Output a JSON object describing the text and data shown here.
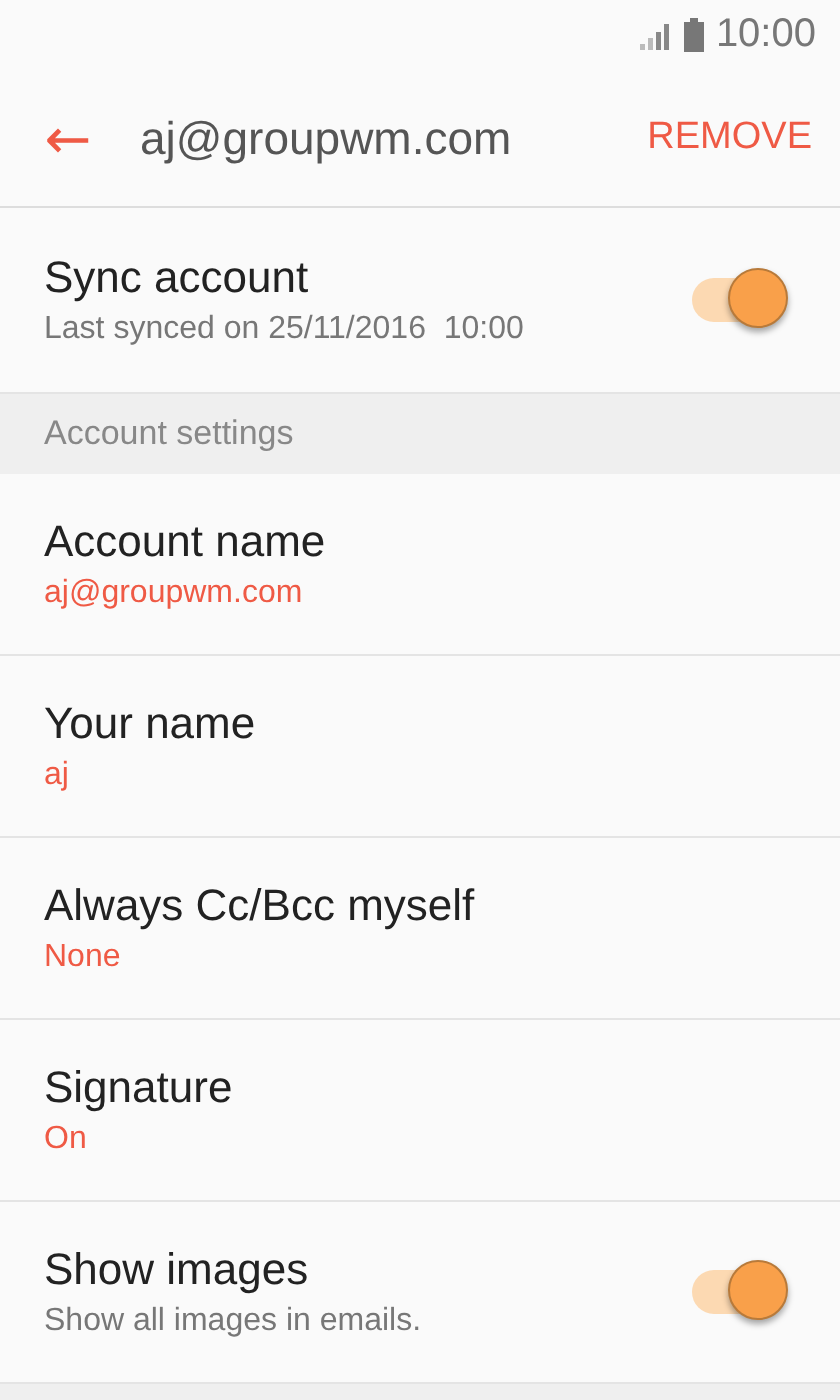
{
  "status_bar": {
    "time": "10:00"
  },
  "toolbar": {
    "back": "←",
    "title": "aj@groupwm.com",
    "action": "REMOVE"
  },
  "sync": {
    "kind": "toggle",
    "title": "Sync account",
    "subtitle": "Last synced on 25/11/2016  10:00",
    "on": true
  },
  "sections": [
    {
      "header": "Account settings",
      "items": [
        {
          "kind": "value",
          "title": "Account name",
          "subtitle": "aj@groupwm.com"
        },
        {
          "kind": "value",
          "title": "Your name",
          "subtitle": "aj"
        },
        {
          "kind": "value",
          "title": "Always Cc/Bcc myself",
          "subtitle": "None"
        },
        {
          "kind": "value",
          "title": "Signature",
          "subtitle": "On"
        },
        {
          "kind": "toggle",
          "title": "Show images",
          "subtitle": "Show all images in emails.",
          "on": true
        }
      ]
    }
  ]
}
